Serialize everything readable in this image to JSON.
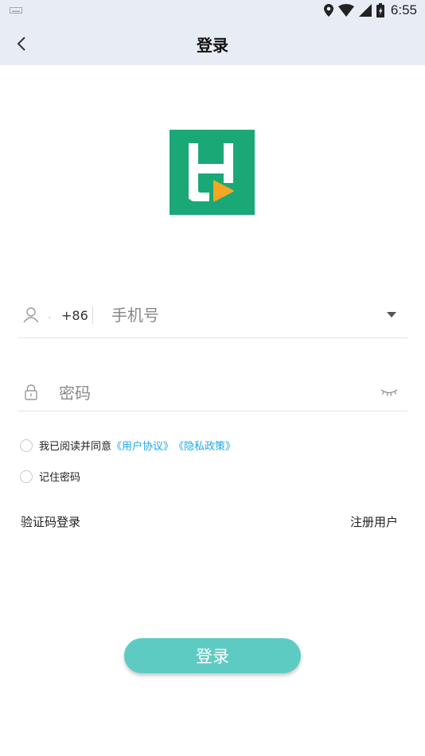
{
  "status_bar": {
    "time": "6:55"
  },
  "header": {
    "title": "登录"
  },
  "phone": {
    "country_code": "+86",
    "placeholder": "手机号"
  },
  "password": {
    "placeholder": "密码"
  },
  "agreement": {
    "prefix": "我已阅读并同意",
    "user_agreement": "《用户协议》",
    "privacy_policy": "《隐私政策》"
  },
  "remember": {
    "label": "记住密码"
  },
  "links": {
    "code_login": "验证码登录",
    "register": "注册用户"
  },
  "login_button": {
    "label": "登录"
  },
  "colors": {
    "accent": "#5ecbc3",
    "logo_bg": "#1aa877",
    "logo_play": "#f5a623",
    "link": "#1fa9e8",
    "header_bg": "#e8edf5"
  },
  "icons": [
    "keyboard-icon",
    "location-icon",
    "wifi-icon",
    "signal-icon",
    "battery-icon",
    "back-arrow-icon",
    "app-logo",
    "user-icon",
    "lock-icon",
    "eye-closed-icon",
    "dropdown-icon"
  ]
}
